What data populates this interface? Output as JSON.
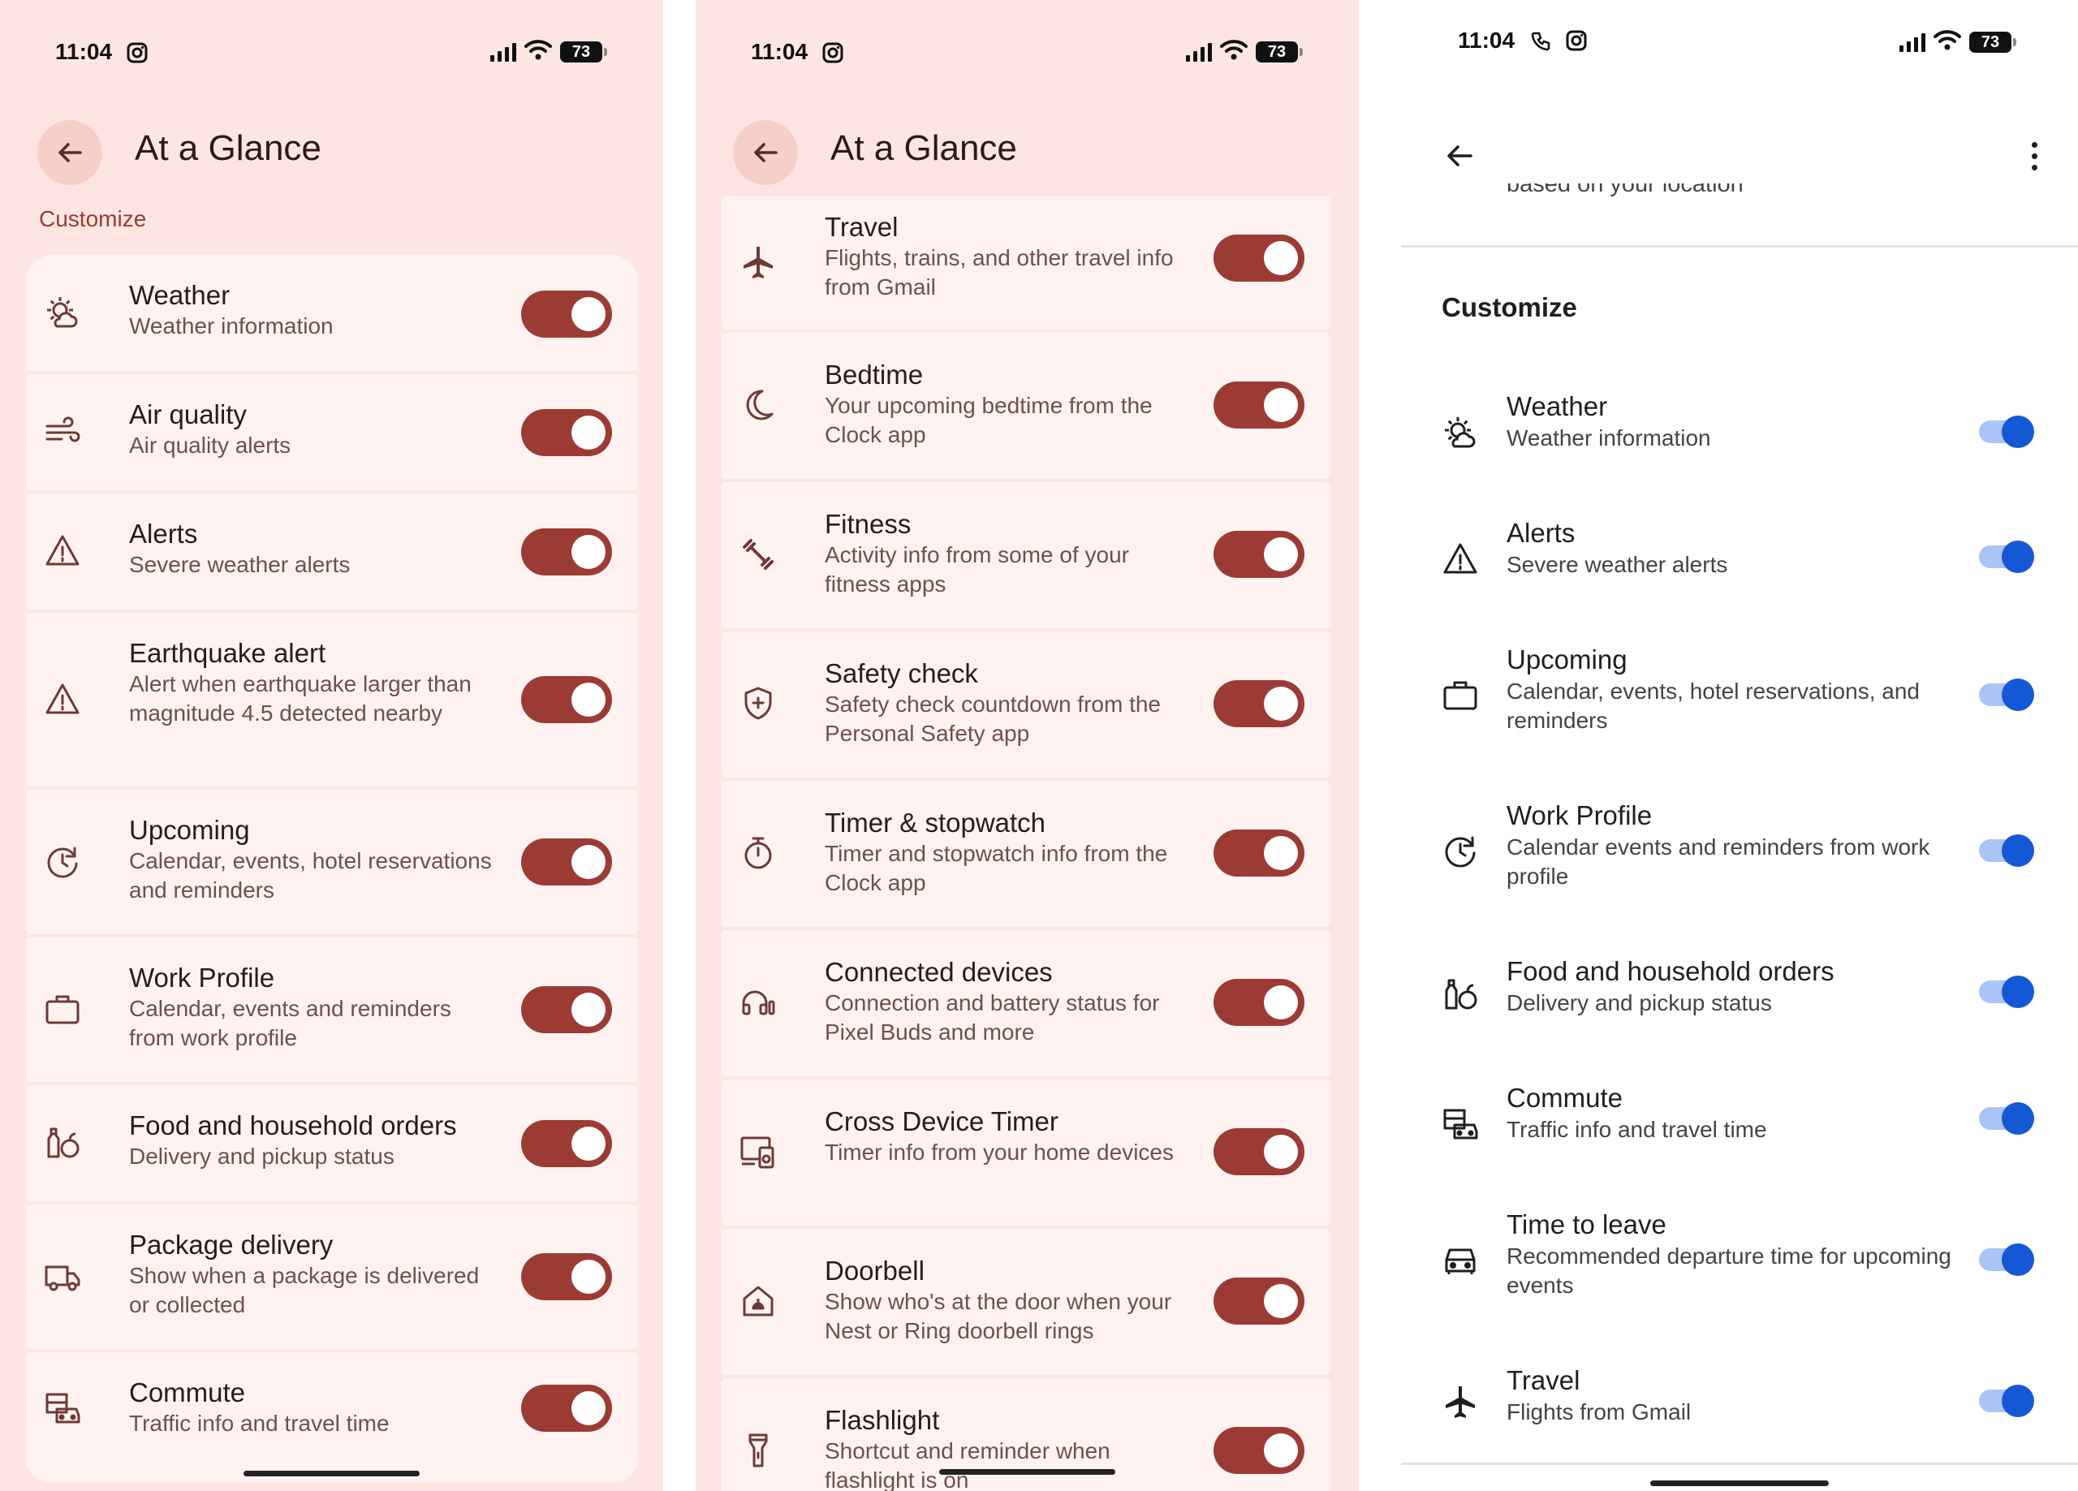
{
  "status": {
    "time": "11:04",
    "battery": "73"
  },
  "p1": {
    "title": "At a Glance",
    "section": "Customize",
    "items": [
      {
        "title": "Weather",
        "subtitle": "Weather information",
        "icon": "weather-icon"
      },
      {
        "title": "Air quality",
        "subtitle": "Air quality alerts",
        "icon": "wind-icon"
      },
      {
        "title": "Alerts",
        "subtitle": "Severe weather alerts",
        "icon": "warning-icon"
      },
      {
        "title": "Earthquake alert",
        "subtitle": "Alert when earthquake larger than magnitude 4.5 detected nearby",
        "icon": "warning-icon"
      },
      {
        "title": "Upcoming",
        "subtitle": "Calendar, events, hotel reservations and reminders",
        "icon": "clock-icon"
      },
      {
        "title": "Work Profile",
        "subtitle": "Calendar, events and reminders from work profile",
        "icon": "briefcase-icon"
      },
      {
        "title": "Food and household orders",
        "subtitle": "Delivery and pickup status",
        "icon": "grocery-icon"
      },
      {
        "title": "Package delivery",
        "subtitle": "Show when a package is delivered or collected",
        "icon": "truck-icon"
      },
      {
        "title": "Commute",
        "subtitle": "Traffic info and travel time",
        "icon": "commute-icon"
      }
    ]
  },
  "p2": {
    "title": "At a Glance",
    "items": [
      {
        "title": "Travel",
        "subtitle": "Flights, trains, and other travel info from Gmail",
        "icon": "airplane-icon"
      },
      {
        "title": "Bedtime",
        "subtitle": "Your upcoming bedtime from the Clock app",
        "icon": "moon-icon"
      },
      {
        "title": "Fitness",
        "subtitle": "Activity info from some of your fitness apps",
        "icon": "dumbbell-icon"
      },
      {
        "title": "Safety check",
        "subtitle": "Safety check countdown from the Personal Safety app",
        "icon": "shield-icon"
      },
      {
        "title": "Timer & stopwatch",
        "subtitle": "Timer and stopwatch info from the Clock app",
        "icon": "stopwatch-icon"
      },
      {
        "title": "Connected devices",
        "subtitle": "Connection and battery status for Pixel Buds and more",
        "icon": "headphones-icon"
      },
      {
        "title": "Cross Device Timer",
        "subtitle": "Timer info from your home devices",
        "icon": "devices-icon"
      },
      {
        "title": "Doorbell",
        "subtitle": "Show who's at the door when your Nest or Ring doorbell rings",
        "icon": "doorbell-icon"
      },
      {
        "title": "Flashlight",
        "subtitle": "Shortcut and reminder when flashlight is on",
        "icon": "flashlight-icon"
      }
    ]
  },
  "p3": {
    "partial_text": "based on your location",
    "section": "Customize",
    "items": [
      {
        "title": "Weather",
        "subtitle": "Weather information",
        "icon": "weather-icon"
      },
      {
        "title": "Alerts",
        "subtitle": "Severe weather alerts",
        "icon": "warning-icon"
      },
      {
        "title": "Upcoming",
        "subtitle": "Calendar, events, hotel reservations, and reminders",
        "icon": "briefcase-icon"
      },
      {
        "title": "Work Profile",
        "subtitle": "Calendar events and reminders from work profile",
        "icon": "clock-icon"
      },
      {
        "title": "Food and household orders",
        "subtitle": "Delivery and pickup status",
        "icon": "grocery-icon"
      },
      {
        "title": "Commute",
        "subtitle": "Traffic info and travel time",
        "icon": "commute-icon"
      },
      {
        "title": "Time to leave",
        "subtitle": "Recommended departure time for upcoming events",
        "icon": "car-icon"
      },
      {
        "title": "Travel",
        "subtitle": "Flights from Gmail",
        "icon": "airplane-icon"
      }
    ]
  },
  "colors": {
    "pink_bg": "#fde6e2",
    "card": "#fff3f1",
    "toggle_on": "#9b3b34",
    "blue_toggle": "#1558d6"
  }
}
